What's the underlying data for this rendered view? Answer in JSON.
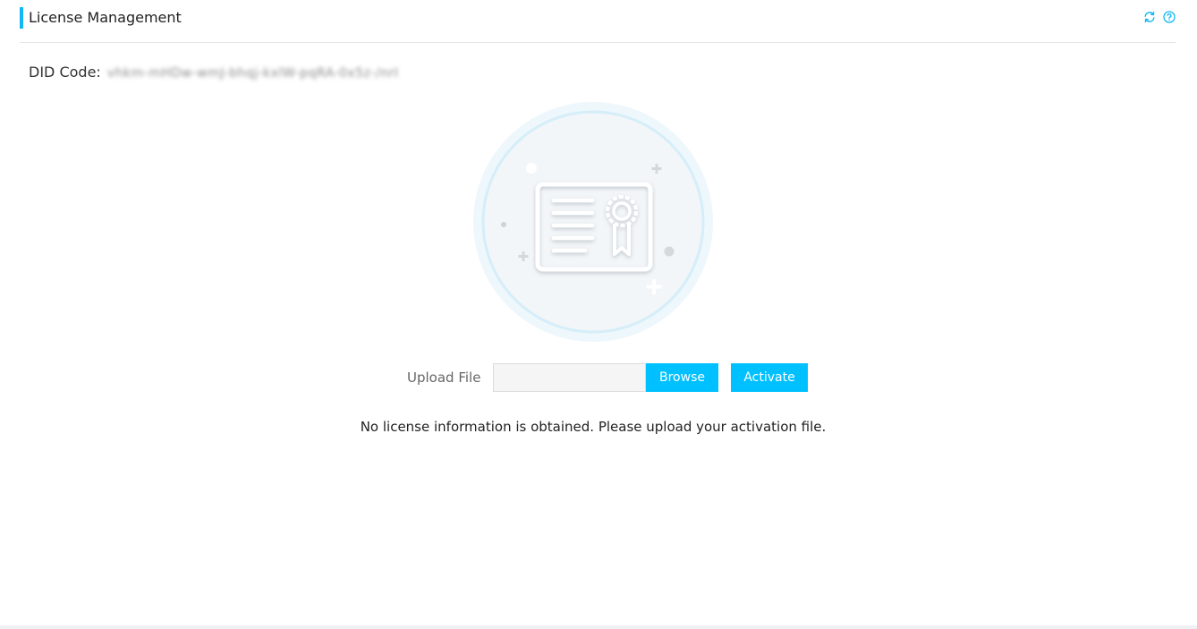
{
  "header": {
    "title": "License Management",
    "icons": [
      "refresh-icon",
      "help-icon"
    ]
  },
  "did": {
    "label": "DID Code:",
    "value": "vhkm-mHDw-wmJ-bhqj-kxlW-pqRA-0x5z-/nrI"
  },
  "upload": {
    "label": "Upload File",
    "value": "",
    "placeholder": "",
    "browse_label": "Browse",
    "activate_label": "Activate"
  },
  "status": {
    "message": "No license information is obtained. Please upload your activation file."
  },
  "colors": {
    "accent": "#12b7f5",
    "button": "#00c0ff",
    "divider": "#e6e6e6"
  }
}
